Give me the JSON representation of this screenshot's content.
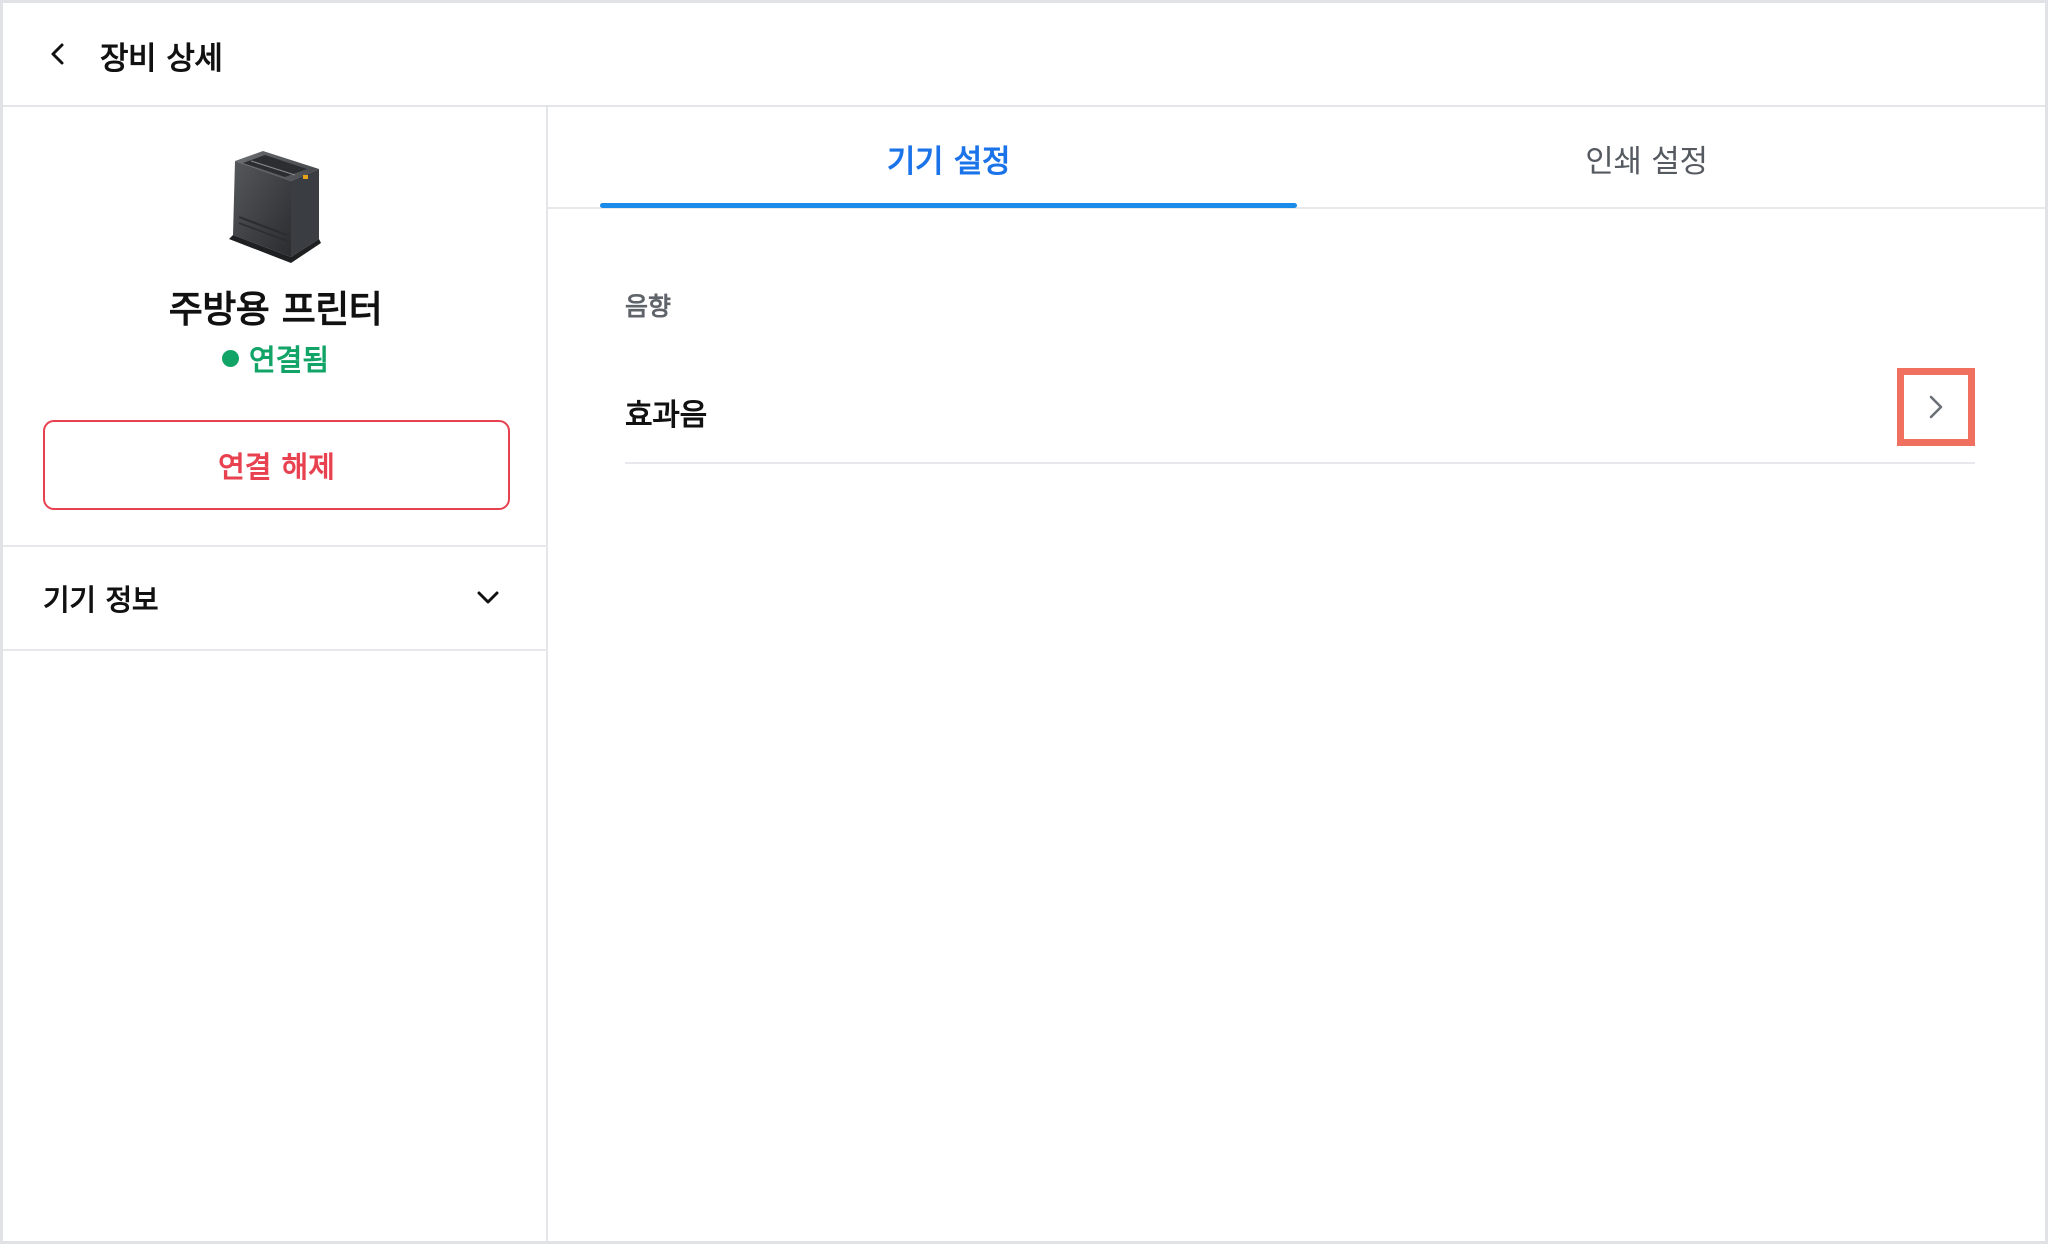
{
  "header": {
    "title": "장비 상세"
  },
  "sidebar": {
    "device_name": "주방용 프린터",
    "status": "연결됨",
    "disconnect_label": "연결 해제",
    "device_info_label": "기기 정보"
  },
  "tabs": [
    {
      "label": "기기 설정",
      "active": true
    },
    {
      "label": "인쇄 설정",
      "active": false
    }
  ],
  "settings": {
    "section_label": "음향",
    "items": [
      {
        "label": "효과음"
      }
    ]
  },
  "colors": {
    "accent_blue": "#1a73e8",
    "status_green": "#12a467",
    "danger_red": "#e8414f",
    "highlight": "#f07060"
  },
  "icons": {
    "back": "chevron-left-icon",
    "expand": "chevron-down-icon",
    "open": "chevron-right-icon",
    "device": "printer-icon"
  }
}
